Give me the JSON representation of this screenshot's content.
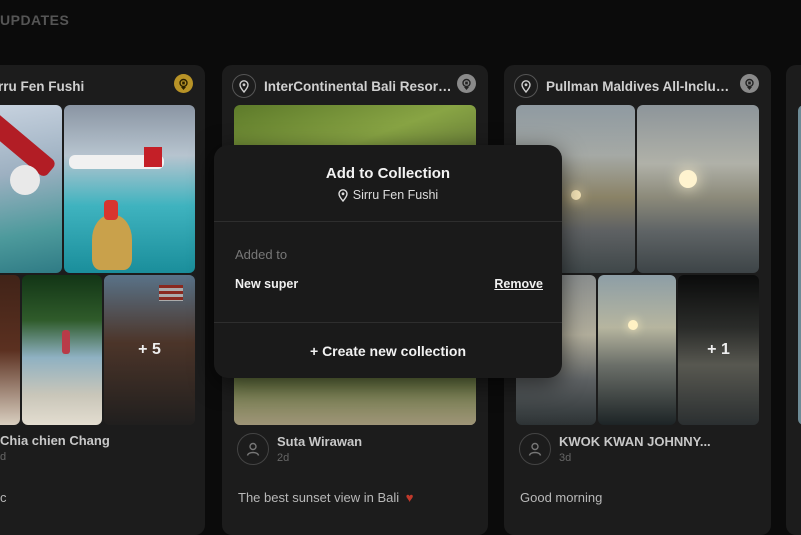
{
  "section": {
    "title": "UPDATES"
  },
  "cards": [
    {
      "location": "rru Fen Fushi",
      "more": "+ 5",
      "author": "Chia chien Chang",
      "time": "d",
      "caption": "c"
    },
    {
      "location": "InterContinental Bali Resort,...",
      "author": "Suta Wirawan",
      "time": "2d",
      "caption": "The best sunset view in Bali",
      "caption_emoji": "♥"
    },
    {
      "location": "Pullman Maldives All-Inclusi...",
      "more": "+ 1",
      "author": "KWOK KWAN JOHNNY...",
      "time": "3d",
      "caption": "Good morning"
    }
  ],
  "modal": {
    "title": "Add to Collection",
    "location": "Sirru Fen Fushi",
    "added_to_label": "Added to",
    "collection_name": "New super",
    "remove_label": "Remove",
    "create_label": "+ Create new collection"
  },
  "colors": {
    "badge_gold": "#b89327",
    "badge_gray": "#8a8a8a",
    "heart": "#c0392b"
  },
  "icons": [
    "location-pin-icon",
    "badge-icon",
    "user-avatar-icon"
  ]
}
